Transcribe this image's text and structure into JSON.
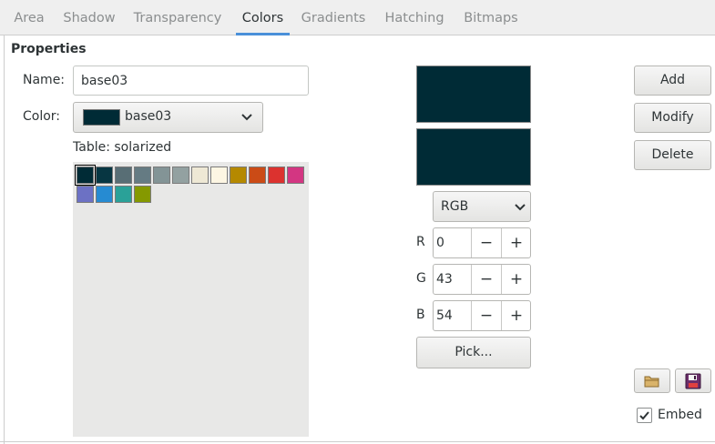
{
  "tabs": [
    {
      "label": "Area",
      "active": false
    },
    {
      "label": "Shadow",
      "active": false
    },
    {
      "label": "Transparency",
      "active": false
    },
    {
      "label": "Colors",
      "active": true
    },
    {
      "label": "Gradients",
      "active": false
    },
    {
      "label": "Hatching",
      "active": false
    },
    {
      "label": "Bitmaps",
      "active": false
    }
  ],
  "properties": {
    "title": "Properties",
    "name_label": "Name:",
    "name_value": "base03",
    "color_label": "Color:",
    "color_value": "base03",
    "table_label": "Table: solarized"
  },
  "palette": {
    "selected": 0,
    "colors": [
      "#002b36",
      "#073642",
      "#586e75",
      "#657b83",
      "#839496",
      "#93a1a1",
      "#eee8d5",
      "#fdf6e3",
      "#b58900",
      "#cb4b16",
      "#dc322f",
      "#d33682",
      "#6c71c4",
      "#268bd2",
      "#2aa198",
      "#859900"
    ]
  },
  "preview": {
    "old_color": "#002b36",
    "new_color": "#002b36"
  },
  "color_mode": "RGB",
  "channels": [
    {
      "label": "R",
      "value": "0"
    },
    {
      "label": "G",
      "value": "43"
    },
    {
      "label": "B",
      "value": "54"
    }
  ],
  "spin_minus": "−",
  "spin_plus": "+",
  "pick_label": "Pick...",
  "buttons": {
    "add": "Add",
    "modify": "Modify",
    "delete": "Delete"
  },
  "embed": {
    "label": "Embed",
    "checked": true
  },
  "icons": {
    "load": "folder-icon",
    "save": "floppy-disk-icon"
  }
}
